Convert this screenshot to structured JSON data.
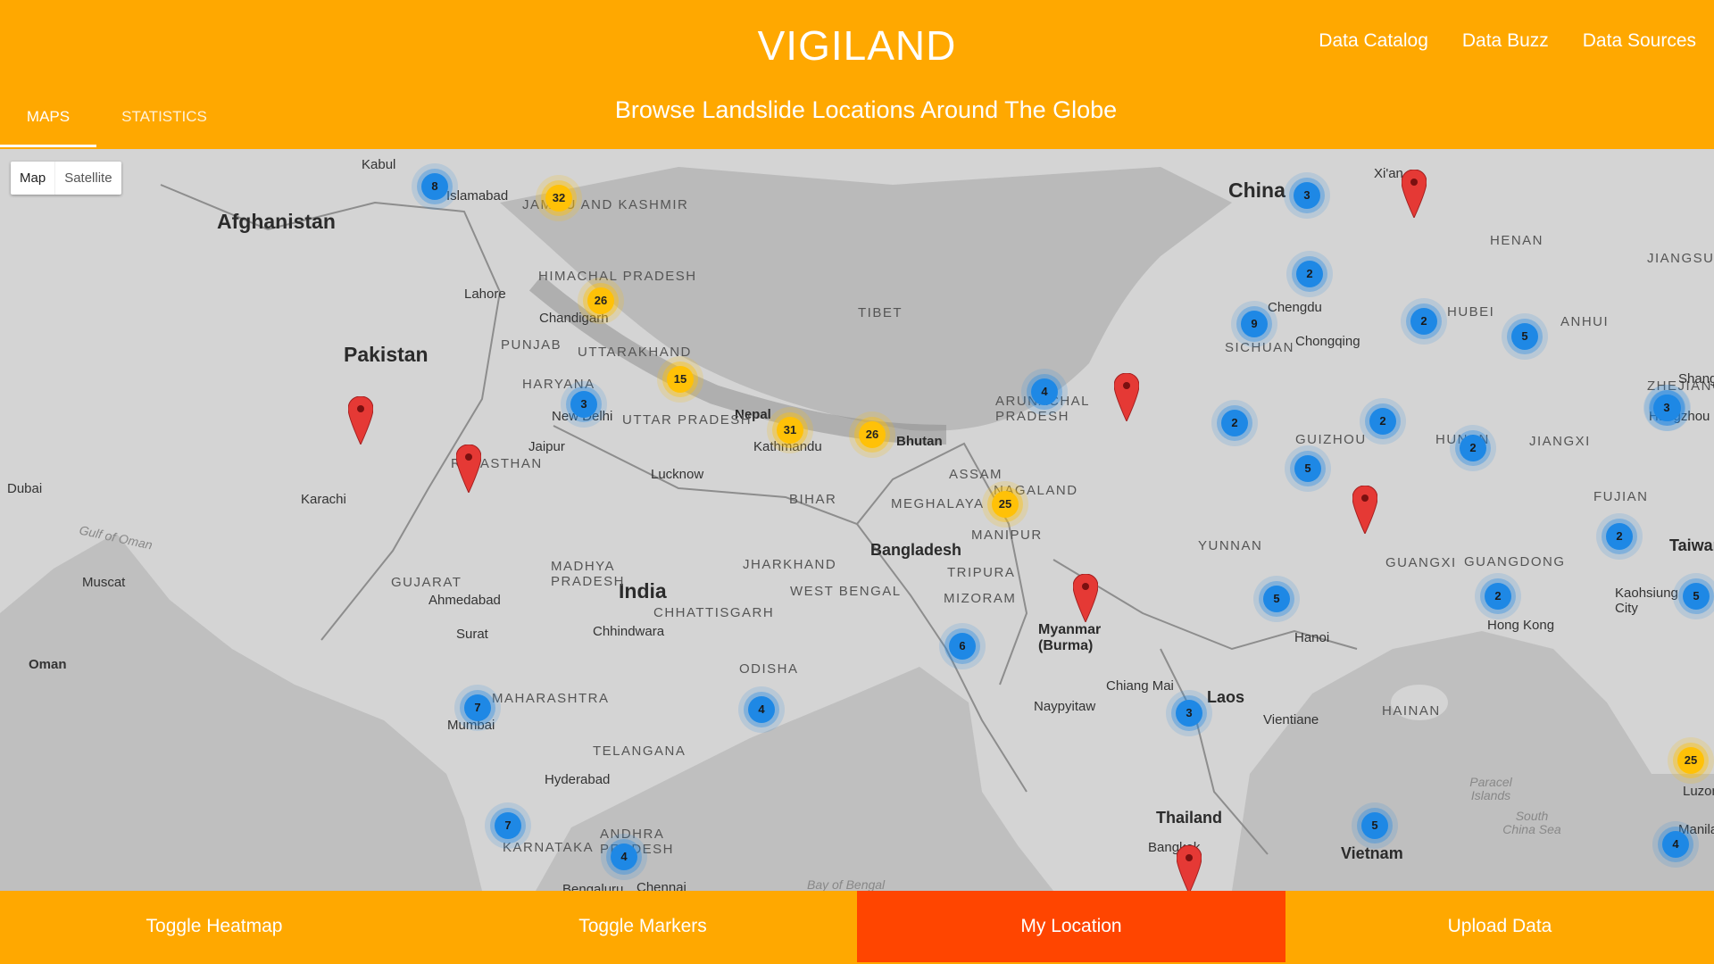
{
  "header": {
    "title": "VIGILAND",
    "subtitle": "Browse Landslide Locations Around The Globe",
    "nav": [
      "Data Catalog",
      "Data Buzz",
      "Data Sources"
    ],
    "tabs": [
      "MAPS",
      "STATISTICS"
    ],
    "active_tab": "MAPS",
    "color": "#ffa800"
  },
  "map": {
    "type_buttons": [
      "Map",
      "Satellite"
    ],
    "active_type": "Map",
    "countries": [
      "Afghanistan",
      "Pakistan",
      "India",
      "China",
      "Bangladesh",
      "Bhutan",
      "Nepal",
      "Myanmar\n(Burma)",
      "Thailand",
      "Laos",
      "Vietnam",
      "Oman",
      "Taiwan"
    ],
    "regions": [
      "JAMMU AND KASHMIR",
      "HIMACHAL PRADESH",
      "PUNJAB",
      "UTTARAKHAND",
      "HARYANA",
      "UTTAR PRADESH",
      "RAJASTHAN",
      "BIHAR",
      "ASSAM",
      "MEGHALAYA",
      "NAGALAND",
      "MANIPUR",
      "TRIPURA",
      "MIZORAM",
      "ARUNACHAL PRADESH",
      "GUJARAT",
      "MADHYA PRADESH",
      "JHARKHAND",
      "WEST BENGAL",
      "CHHATTISGARH",
      "ODISHA",
      "MAHARASHTRA",
      "TELANGANA",
      "ANDHRA PRADESH",
      "KARNATAKA",
      "TIBET",
      "SICHUAN",
      "YUNNAN",
      "GUIZHOU",
      "GUANGXI",
      "GUANGDONG",
      "HUBEI",
      "HENAN",
      "ANHUI",
      "JIANGSU",
      "JIANGXI",
      "ZHEJIANG",
      "FUJIAN",
      "HUNAN",
      "HAINAN"
    ],
    "cities": [
      "Kabul",
      "Islamabad",
      "Lahore",
      "Chandigarh",
      "New Delhi",
      "Jaipur",
      "Lucknow",
      "Kathmandu",
      "Karachi",
      "Ahmedabad",
      "Surat",
      "Mumbai",
      "Hyderabad",
      "Chhindwara",
      "Chennai",
      "Bengaluru",
      "Dubai",
      "Muscat",
      "Chengdu",
      "Chongqing",
      "Xi'an",
      "Hanoi",
      "Hong Kong",
      "Vientiane",
      "Naypyitaw",
      "Chiang Mai",
      "Bangkok",
      "Kaohsiung City",
      "Hangzhou",
      "Shanghai",
      "Luzon",
      "Manila"
    ],
    "seas": [
      "Gulf of Oman",
      "Bay of Bengal",
      "South China Sea",
      "Paracel Islands"
    ],
    "clusters": [
      {
        "count": "8",
        "color": "blue"
      },
      {
        "count": "32",
        "color": "yellow"
      },
      {
        "count": "26",
        "color": "yellow"
      },
      {
        "count": "15",
        "color": "yellow"
      },
      {
        "count": "3",
        "color": "blue"
      },
      {
        "count": "31",
        "color": "yellow"
      },
      {
        "count": "26",
        "color": "yellow"
      },
      {
        "count": "4",
        "color": "blue"
      },
      {
        "count": "25",
        "color": "yellow"
      },
      {
        "count": "6",
        "color": "blue"
      },
      {
        "count": "7",
        "color": "blue"
      },
      {
        "count": "4",
        "color": "blue"
      },
      {
        "count": "7",
        "color": "blue"
      },
      {
        "count": "4",
        "color": "blue"
      },
      {
        "count": "3",
        "color": "blue"
      },
      {
        "count": "2",
        "color": "blue"
      },
      {
        "count": "9",
        "color": "blue"
      },
      {
        "count": "2",
        "color": "blue"
      },
      {
        "count": "5",
        "color": "blue"
      },
      {
        "count": "2",
        "color": "blue"
      },
      {
        "count": "2",
        "color": "blue"
      },
      {
        "count": "5",
        "color": "blue"
      },
      {
        "count": "2",
        "color": "blue"
      },
      {
        "count": "2",
        "color": "blue"
      },
      {
        "count": "5",
        "color": "blue"
      },
      {
        "count": "2",
        "color": "blue"
      },
      {
        "count": "3",
        "color": "blue"
      },
      {
        "count": "2",
        "color": "blue"
      },
      {
        "count": "5",
        "color": "blue"
      },
      {
        "count": "3",
        "color": "blue"
      },
      {
        "count": "5",
        "color": "blue"
      },
      {
        "count": "25",
        "color": "yellow"
      },
      {
        "count": "4",
        "color": "blue"
      }
    ],
    "pin_color": "#e53935"
  },
  "footer": {
    "buttons": [
      "Toggle Heatmap",
      "Toggle Markers",
      "My Location",
      "Upload Data"
    ],
    "active_button": "My Location",
    "active_color": "#ff4500"
  }
}
